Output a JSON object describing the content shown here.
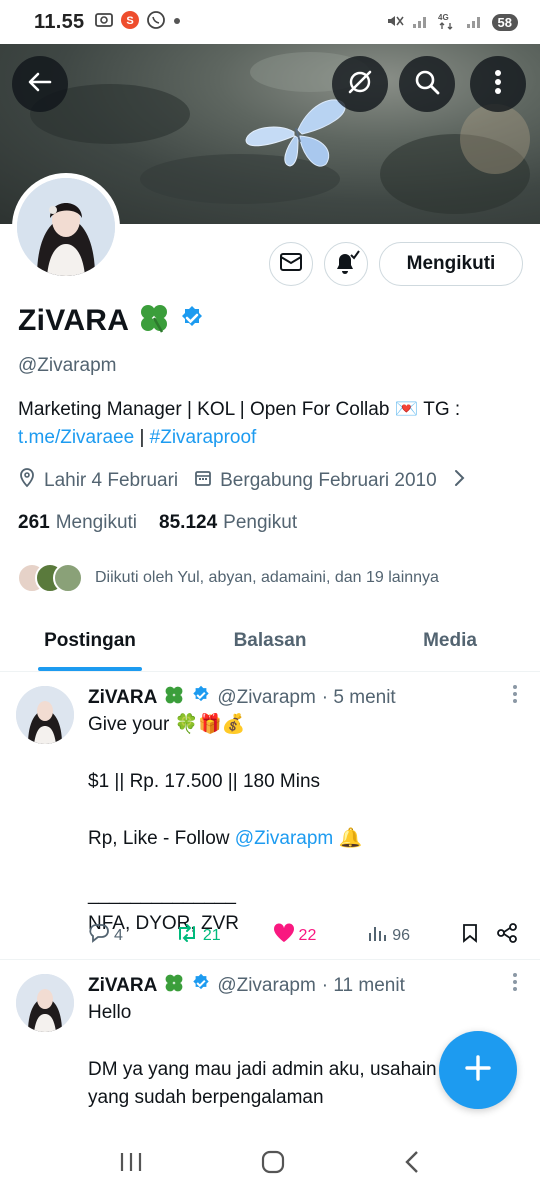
{
  "status_bar": {
    "time": "11.55",
    "battery": "58"
  },
  "profile": {
    "display_name": "ZiVARA",
    "handle": "@Zivarapm",
    "follow_button": "Mengikuti",
    "bio_text": "Marketing Manager | KOL | Open For Collab 💌 TG :",
    "bio_link_1": "t.me/Zivaraee",
    "bio_separator": "|",
    "bio_link_2": "#Zivaraproof",
    "birthday": "Lahir 4 Februari",
    "joined": "Bergabung Februari 2010",
    "following_count": "261",
    "following_label": "Mengikuti",
    "followers_count": "85.124",
    "followers_label": "Pengikut",
    "followed_by": "Diikuti oleh Yul, abyan, adamaini, dan 19 lainnya"
  },
  "tabs": [
    {
      "label": "Postingan"
    },
    {
      "label": "Balasan"
    },
    {
      "label": "Media"
    }
  ],
  "posts": [
    {
      "name": "ZiVARA",
      "handle": "@Zivarapm",
      "time": "· 5 menit",
      "line1": "Give your 🍀🎁💰",
      "line2": "$1 || Rp. 17.500 || 180 Mins",
      "line3_prefix": "Rp, Like - Follow",
      "line3_mention": "@Zivarapm",
      "line3_suffix": "🔔",
      "line4": "______________",
      "line5": "NFA, DYOR, ZVR",
      "replies": "4",
      "reposts": "21",
      "likes": "22",
      "views": "96"
    },
    {
      "name": "ZiVARA",
      "handle": "@Zivarapm",
      "time": "· 11 menit",
      "line1": "Hello",
      "line2": "DM ya yang mau jadi admin aku, usahain",
      "line3": "yang sudah berpengalaman"
    }
  ],
  "colors": {
    "accent": "#1d9bf0",
    "repost": "#00ba7c",
    "like": "#f91880",
    "secondary_text": "#536471"
  }
}
